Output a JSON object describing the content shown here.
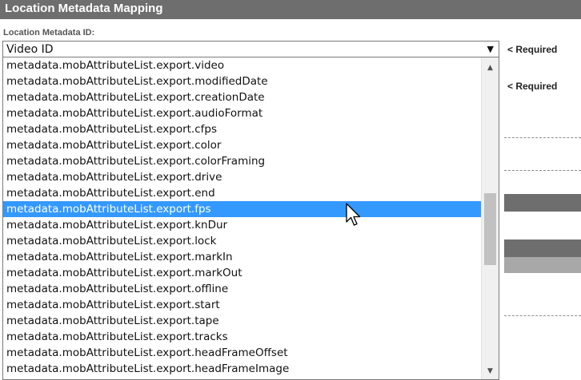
{
  "header": {
    "title": "Location Metadata Mapping"
  },
  "field": {
    "label": "Location Metadata ID:",
    "selected_value": "Video ID",
    "required_label": "< Required",
    "dropdown_arrow_icon": "triangle-down"
  },
  "second_field": {
    "required_label": "< Required"
  },
  "dropdown": {
    "items": [
      "metadata.mobAttributeList.export.video",
      "metadata.mobAttributeList.export.modifiedDate",
      "metadata.mobAttributeList.export.creationDate",
      "metadata.mobAttributeList.export.audioFormat",
      "metadata.mobAttributeList.export.cfps",
      "metadata.mobAttributeList.export.color",
      "metadata.mobAttributeList.export.colorFraming",
      "metadata.mobAttributeList.export.drive",
      "metadata.mobAttributeList.export.end",
      "metadata.mobAttributeList.export.fps",
      "metadata.mobAttributeList.export.knDur",
      "metadata.mobAttributeList.export.lock",
      "metadata.mobAttributeList.export.markIn",
      "metadata.mobAttributeList.export.markOut",
      "metadata.mobAttributeList.export.offline",
      "metadata.mobAttributeList.export.start",
      "metadata.mobAttributeList.export.tape",
      "metadata.mobAttributeList.export.tracks",
      "metadata.mobAttributeList.export.headFrameOffset",
      "metadata.mobAttributeList.export.headFrameImage"
    ],
    "highlighted_item": "metadata.mobAttributeList.export.fps"
  },
  "colors": {
    "header_bg": "#6e6e6e",
    "selection": "#3399ff",
    "section_bar_dark": "#6e6e6e",
    "section_bar_light": "#a8a8a8"
  },
  "icons": {
    "scroll_up": "triangle-up-icon",
    "scroll_down": "triangle-down-icon",
    "cursor": "arrow-pointer-icon"
  }
}
